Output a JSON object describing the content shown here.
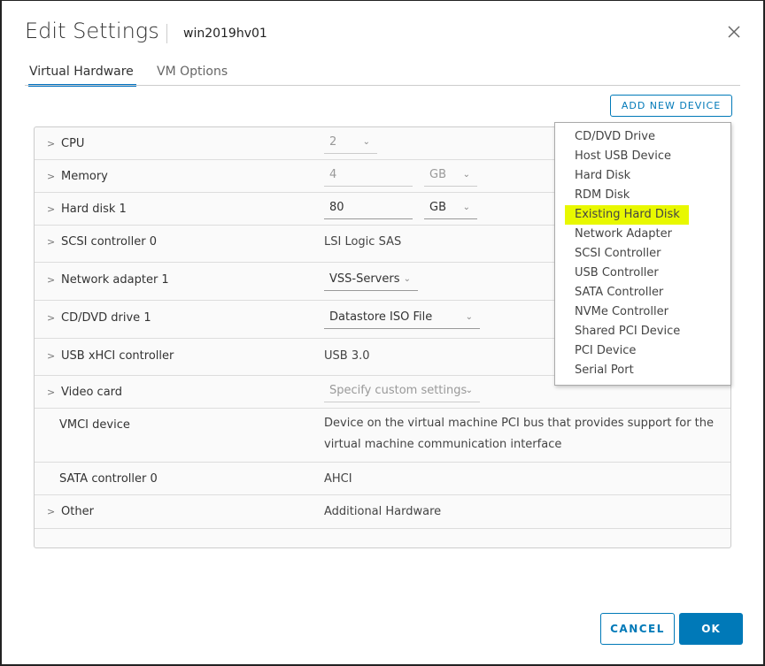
{
  "header": {
    "title": "Edit Settings",
    "vm_name": "win2019hv01"
  },
  "tabs": [
    {
      "label": "Virtual Hardware"
    },
    {
      "label": "VM Options"
    }
  ],
  "toolbar": {
    "add_new_device": "ADD NEW DEVICE"
  },
  "rows": {
    "cpu": {
      "label": "CPU",
      "value": "2"
    },
    "memory": {
      "label": "Memory",
      "value": "4",
      "unit": "GB"
    },
    "hard_disk": {
      "label": "Hard disk 1",
      "value": "80",
      "unit": "GB"
    },
    "scsi": {
      "label": "SCSI controller 0",
      "value": "LSI Logic SAS"
    },
    "network": {
      "label": "Network adapter 1",
      "value": "VSS-Servers"
    },
    "cddvd": {
      "label": "CD/DVD drive 1",
      "value": "Datastore ISO File"
    },
    "usb": {
      "label": "USB xHCI controller",
      "value": "USB 3.0"
    },
    "video": {
      "label": "Video card",
      "value": "Specify custom settings"
    },
    "vmci": {
      "label": "VMCI device",
      "value_line1": "Device on the virtual machine PCI bus that provides support for the",
      "value_line2": "virtual machine communication interface"
    },
    "sata": {
      "label": "SATA controller 0",
      "value": "AHCI"
    },
    "other": {
      "label": "Other",
      "value": "Additional Hardware"
    }
  },
  "menu": {
    "items": [
      "CD/DVD Drive",
      "Host USB Device",
      "Hard Disk",
      "RDM Disk",
      "Existing Hard Disk",
      "Network Adapter",
      "SCSI Controller",
      "USB Controller",
      "SATA Controller",
      "NVMe Controller",
      "Shared PCI Device",
      "PCI Device",
      "Serial Port"
    ],
    "highlighted": "Existing Hard Disk",
    "highlight_color": "#e8f800"
  },
  "footer": {
    "cancel": "CANCEL",
    "ok": "OK"
  },
  "colors": {
    "accent": "#0079b8"
  }
}
